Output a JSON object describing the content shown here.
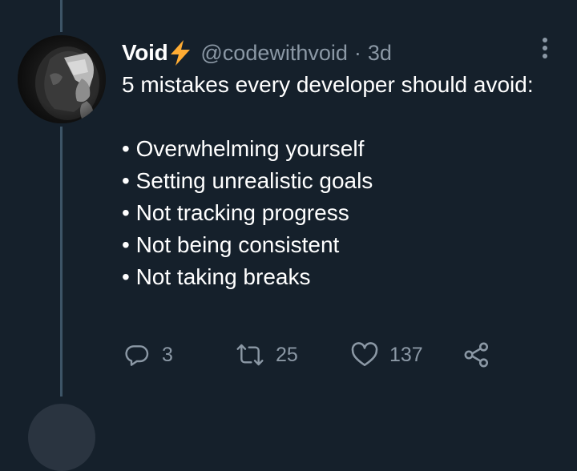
{
  "tweet": {
    "display_name": "Void",
    "name_emoji": "high-voltage-emoji",
    "handle": "@codewithvoid",
    "separator": "·",
    "time": "3d",
    "text_intro": "5 mistakes every developer should avoid:",
    "bullets": [
      "• Overwhelming yourself",
      "• Setting unrealistic goals",
      "• Not tracking progress",
      "• Not being consistent",
      "• Not taking breaks"
    ]
  },
  "actions": {
    "reply": {
      "icon": "reply-icon",
      "count": "3"
    },
    "retweet": {
      "icon": "retweet-icon",
      "count": "25"
    },
    "like": {
      "icon": "heart-icon",
      "count": "137"
    },
    "share": {
      "icon": "share-icon"
    }
  },
  "colors": {
    "background": "#15202b",
    "text_primary": "#ffffff",
    "text_secondary": "#8b98a5",
    "thread_line": "#3d5466",
    "emoji_yellow": "#ffac33"
  }
}
